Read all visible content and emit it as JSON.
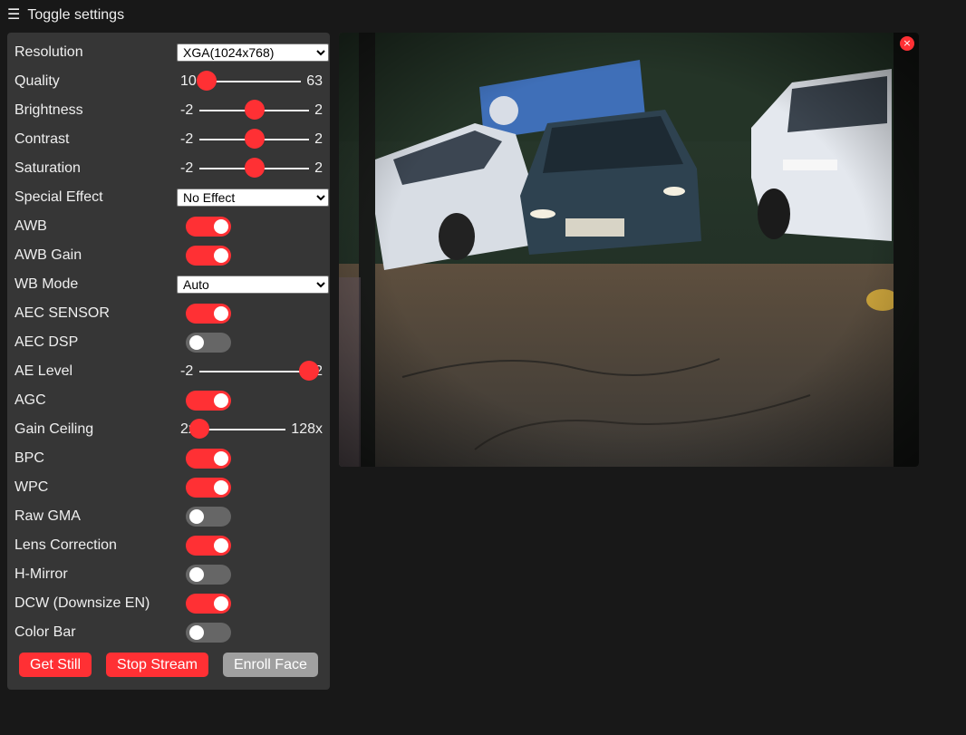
{
  "header": {
    "title": "Toggle settings",
    "menu_icon": "hamburger-icon"
  },
  "controls": {
    "resolution": {
      "label": "Resolution",
      "value": "XGA(1024x768)"
    },
    "quality": {
      "label": "Quality",
      "min": "10",
      "max": "63",
      "value": 10
    },
    "brightness": {
      "label": "Brightness",
      "min": "-2",
      "max": "2",
      "value": 0
    },
    "contrast": {
      "label": "Contrast",
      "min": "-2",
      "max": "2",
      "value": 0
    },
    "saturation": {
      "label": "Saturation",
      "min": "-2",
      "max": "2",
      "value": 0
    },
    "special_effect": {
      "label": "Special Effect",
      "value": "No Effect"
    },
    "awb": {
      "label": "AWB",
      "on": true
    },
    "awb_gain": {
      "label": "AWB Gain",
      "on": true
    },
    "wb_mode": {
      "label": "WB Mode",
      "value": "Auto"
    },
    "aec_sensor": {
      "label": "AEC SENSOR",
      "on": true
    },
    "aec_dsp": {
      "label": "AEC DSP",
      "on": false
    },
    "ae_level": {
      "label": "AE Level",
      "min": "-2",
      "max": "2",
      "value": 2
    },
    "agc": {
      "label": "AGC",
      "on": true
    },
    "gain_ceiling": {
      "label": "Gain Ceiling",
      "min": "2x",
      "max": "128x",
      "value": 0
    },
    "bpc": {
      "label": "BPC",
      "on": true
    },
    "wpc": {
      "label": "WPC",
      "on": true
    },
    "raw_gma": {
      "label": "Raw GMA",
      "on": false
    },
    "lens_correction": {
      "label": "Lens Correction",
      "on": true
    },
    "h_mirror": {
      "label": "H-Mirror",
      "on": false
    },
    "dcw": {
      "label": "DCW (Downsize EN)",
      "on": true
    },
    "color_bar": {
      "label": "Color Bar",
      "on": false
    }
  },
  "buttons": {
    "get_still": "Get Still",
    "stop_stream": "Stop Stream",
    "enroll_face": "Enroll Face"
  },
  "preview": {
    "close_icon": "×"
  },
  "colors": {
    "accent": "#ff3034",
    "panel": "#363636",
    "background": "#181818",
    "toggle_off": "#666666",
    "button_disabled": "#a0a0a0"
  }
}
